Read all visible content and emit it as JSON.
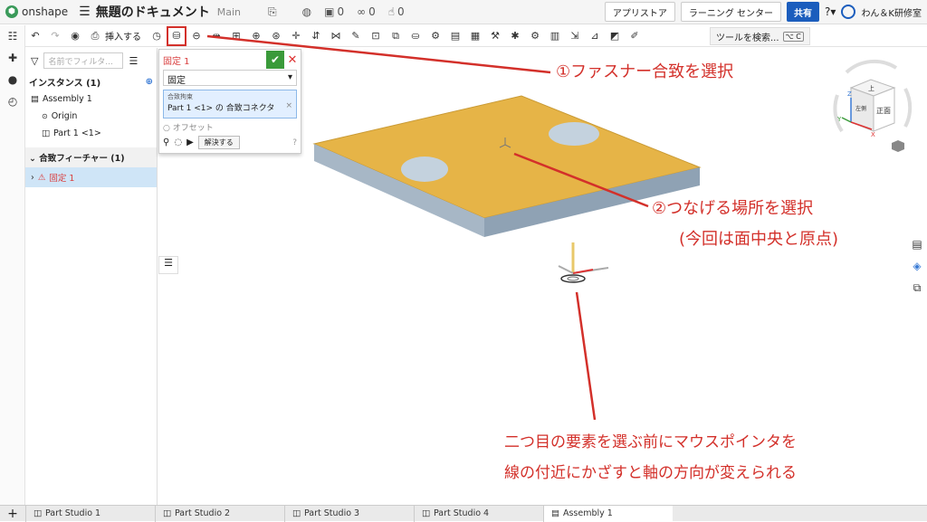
{
  "header": {
    "logo_text": "onshape",
    "doc_title": "無題のドキュメント",
    "branch": "Main",
    "counts": [
      "0",
      "0",
      "0"
    ],
    "app_store": "アプリストア",
    "learning_center": "ラーニング センター",
    "share": "共有",
    "user": "わん＆K研修室"
  },
  "toolbar": {
    "insert_label": "挿入する",
    "search_label": "ツールを検索...",
    "search_shortcut": "⌥ C"
  },
  "panel": {
    "filter_placeholder": "名前でフィルタ...",
    "instances_header": "インスタンス (1)",
    "assembly": "Assembly 1",
    "origin": "Origin",
    "part": "Part 1 <1>",
    "mate_features_header": "合致フィーチャー (1)",
    "mate_item": "固定 1"
  },
  "dialog": {
    "title": "固定 1",
    "type_value": "固定",
    "box_label": "合致拘束",
    "box_value": "Part 1 <1> の 合致コネクタ",
    "offset_label": "オフセット",
    "solve_label": "解決する"
  },
  "viewcube": {
    "top_label": "上",
    "front_label": "正面",
    "left_label": "左側",
    "x_axis": "X",
    "y_axis": "Y",
    "z_axis": "Z"
  },
  "annotations": {
    "a1": "①ファスナー合致を選択",
    "a2_line1": "②つなげる場所を選択",
    "a2_line2": "(今回は面中央と原点)",
    "a3_line1": "二つ目の要素を選ぶ前にマウスポインタを",
    "a3_line2": "線の付近にかざすと軸の方向が変えられる"
  },
  "tabs": [
    {
      "label": "Part Studio 1"
    },
    {
      "label": "Part Studio 2"
    },
    {
      "label": "Part Studio 3"
    },
    {
      "label": "Part Studio 4"
    },
    {
      "label": "Assembly 1"
    }
  ],
  "colors": {
    "plate_top": "#e6b447",
    "plate_side": "#a7b7c6",
    "accent_red": "#d3302a",
    "share_blue": "#1b5dbd"
  }
}
